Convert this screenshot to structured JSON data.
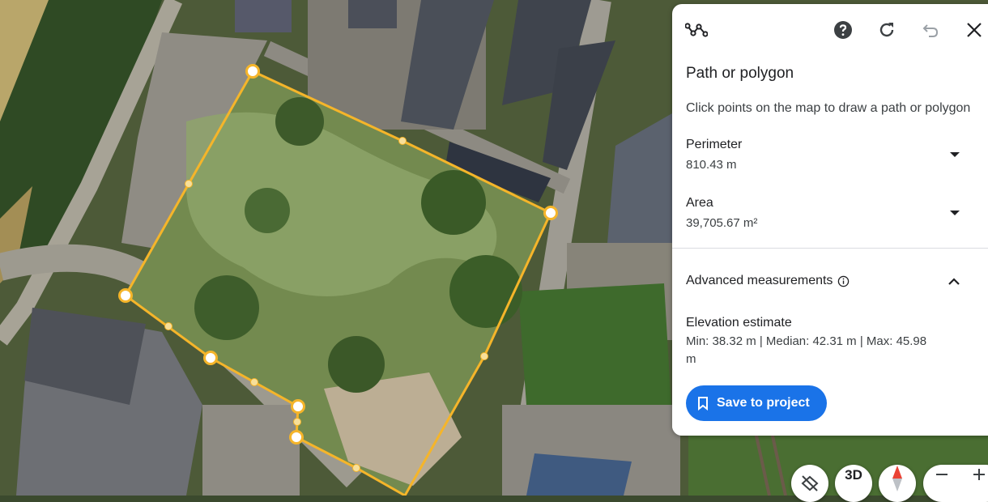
{
  "panel": {
    "title": "Path or polygon",
    "instruction": "Click points on the map to draw a path or polygon",
    "perimeter": {
      "label": "Perimeter",
      "value": "810.43 m"
    },
    "area": {
      "label": "Area",
      "value": "39,705.67 m²"
    },
    "advanced": {
      "label": "Advanced measurements"
    },
    "elevation": {
      "label": "Elevation estimate",
      "value": "Min: 38.32 m | Median: 42.31 m | Max: 45.98 m"
    },
    "save_label": "Save to project"
  },
  "toolbar_icons": [
    "path-tool-icon",
    "help-icon",
    "refresh-icon",
    "undo-icon",
    "close-icon"
  ],
  "map_controls": {
    "three_d_label": "3D"
  },
  "colors": {
    "accent": "#1a73e8",
    "polygon_stroke": "#f5b52a",
    "vertex_fill": "#ffffff"
  }
}
